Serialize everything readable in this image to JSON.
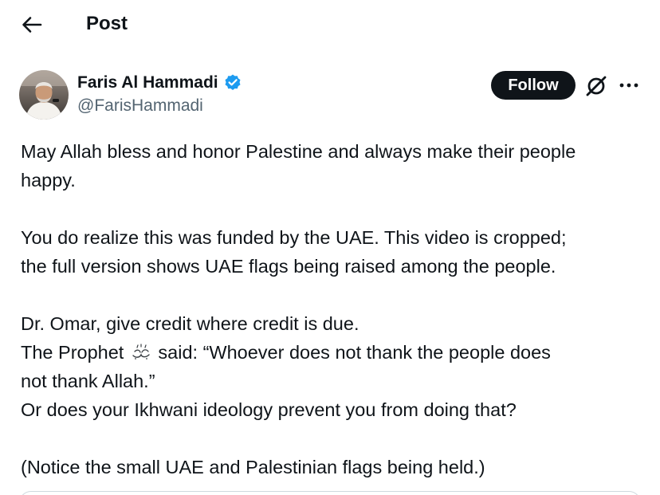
{
  "header": {
    "title": "Post",
    "back_icon": "arrow-left-icon"
  },
  "author": {
    "name": "Faris Al Hammadi",
    "handle": "@FarisHammadi",
    "verified_icon": "verified-badge-icon",
    "verified_color": "#1d9bf0"
  },
  "actions": {
    "follow_label": "Follow",
    "grok_icon": "grok-icon",
    "more_icon": "more-horizontal-icon"
  },
  "post": {
    "p1": {
      "line1": "May Allah bless and honor Palestine and always make their people",
      "line2": "happy."
    },
    "p2": {
      "line1": "You do realize this was funded by the UAE. This video is cropped;",
      "line2": "the full version shows UAE flags being raised among the people."
    },
    "p3": {
      "line1": "Dr. Omar, give credit where credit is due.",
      "line2_before": "The Prophet",
      "line2_after": " said: “Whoever does not thank the people does",
      "line3": "not thank Allah.”",
      "line4": "Or does your Ikhwani ideology prevent you from doing that?",
      "honorific_icon": "salawat-honorific-icon"
    },
    "p4": {
      "line1": "(Notice the small UAE and Palestinian flags being held.)"
    }
  },
  "colors": {
    "text": "#0f1419",
    "secondary_text": "#536471",
    "follow_bg": "#0f1419",
    "follow_text": "#ffffff"
  }
}
